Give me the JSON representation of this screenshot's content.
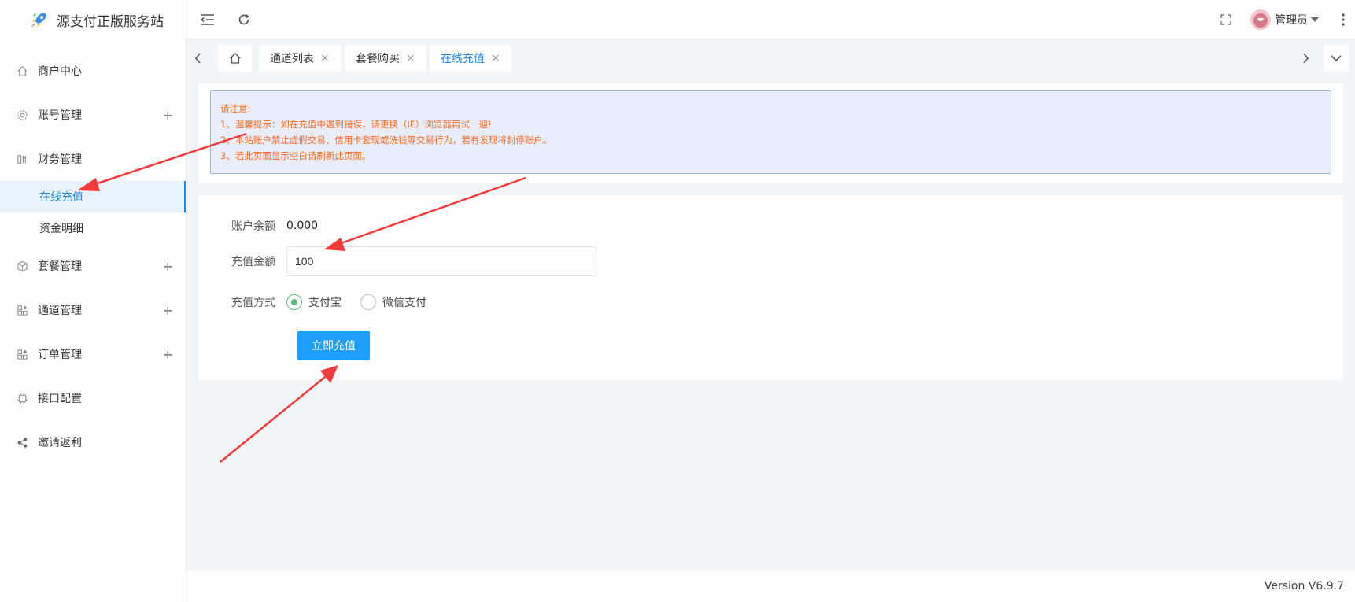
{
  "brand": {
    "title": "源支付正版服务站"
  },
  "sidebar": {
    "items": [
      {
        "label": "商户中心",
        "icon": "home-icon",
        "expandable": false
      },
      {
        "label": "账号管理",
        "icon": "gear-icon",
        "expandable": true
      },
      {
        "label": "财务管理",
        "icon": "finance-icon",
        "expandable": false
      }
    ],
    "sub_items": [
      {
        "label": "在线充值",
        "active": true
      },
      {
        "label": "资金明细",
        "active": false
      }
    ],
    "items_after": [
      {
        "label": "套餐管理",
        "icon": "package-icon",
        "expandable": true
      },
      {
        "label": "通道管理",
        "icon": "channel-icon",
        "expandable": true
      },
      {
        "label": "订单管理",
        "icon": "order-icon",
        "expandable": true
      },
      {
        "label": "接口配置",
        "icon": "api-icon",
        "expandable": false
      },
      {
        "label": "邀请返利",
        "icon": "share-icon",
        "expandable": false
      }
    ],
    "plus": "+"
  },
  "topbar": {
    "user_name": "管理员"
  },
  "tabs": [
    {
      "label": "通道列表",
      "active": false
    },
    {
      "label": "套餐购买",
      "active": false
    },
    {
      "label": "在线充值",
      "active": true
    }
  ],
  "tab_close": "×",
  "notice": {
    "title": "请注意:",
    "lines": [
      "1、温馨提示：如在充值中遇到错误，请更换（IE）浏览器再试一遍!",
      "2、本站账户禁止虚假交易、信用卡套现或洗钱等交易行为，若有发现将封停账户。",
      "3、若此页面显示空白请刷新此页面。"
    ]
  },
  "form": {
    "balance_label": "账户余额",
    "balance_value": "0.000",
    "amount_label": "充值金额",
    "amount_value": "100",
    "method_label": "充值方式",
    "methods": [
      {
        "label": "支付宝",
        "checked": true
      },
      {
        "label": "微信支付",
        "checked": false
      }
    ],
    "submit_label": "立即充值"
  },
  "footer": {
    "version": "Version V6.9.7"
  },
  "colors": {
    "accent": "#1e88e5",
    "button": "#1e9fff",
    "notice_text": "#ff6a1a",
    "notice_bg": "#e9edfd",
    "radio_checked": "#5fb878",
    "annotation_arrow": "#f23a3a"
  }
}
